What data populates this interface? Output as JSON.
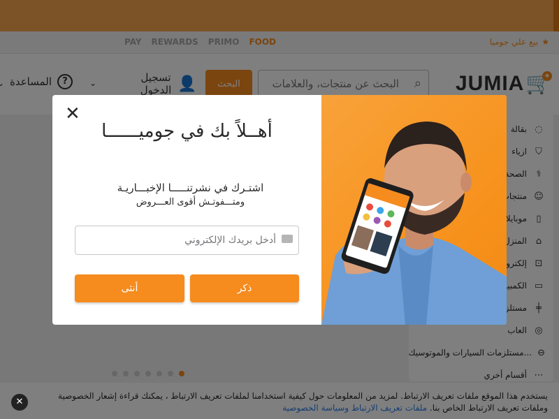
{
  "topbar": {
    "sell_label": "بيع علي جوميا",
    "brands": [
      "PAY",
      "REWARDS",
      "PRIMO",
      "FOOD"
    ]
  },
  "header": {
    "logo": "JUMIA",
    "search_placeholder": "البحث عن منتجات، والعلامات",
    "search_button": "البحث",
    "account_label": "تسجيل الدخول",
    "help_label": "المساعدة"
  },
  "sidebar": {
    "items": [
      {
        "label": "بقالة",
        "icon": "apple-icon"
      },
      {
        "label": "ازياء",
        "icon": "shirt-icon"
      },
      {
        "label": "الصحة",
        "icon": "health-icon"
      },
      {
        "label": "منتجات",
        "icon": "baby-icon"
      },
      {
        "label": "موبايلات",
        "icon": "phone-icon"
      },
      {
        "label": "المنزل",
        "icon": "home-icon"
      },
      {
        "label": "إلكترون",
        "icon": "radio-icon"
      },
      {
        "label": "الكمبيو",
        "icon": "monitor-icon"
      },
      {
        "label": "مستلزم",
        "icon": "dumbbell-icon"
      },
      {
        "label": "العاب",
        "icon": "gamepad-icon"
      },
      {
        "label": "مستلزمات السيارات والموتوسيك...",
        "icon": "car-icon"
      },
      {
        "label": "أقسام أخري",
        "icon": "more-icon"
      }
    ]
  },
  "carousel": {
    "active_index": 0,
    "count": 7
  },
  "modal": {
    "title": "أهــلاً بك في جوميــــــا",
    "subtitle1": "اشتـرك في نشرتنـــــا الإخبـــاريـة",
    "subtitle2": "ومتـــفوتـش أقوى العـــروض",
    "email_placeholder": "أدخل بريدك الإلكتروني",
    "male_button": "ذكر",
    "female_button": "أنثى"
  },
  "cookie": {
    "text": "يستخدم هذا الموقع ملفات تعريف الارتباط. لمزيد من المعلومات حول كيفية استخدامنا لملفات تعريف الارتباط ، يمكنك قراءة إشعار الخصوصية وملفات تعريف الارتباط الخاص بنا. ",
    "link": "ملفات تعريف الارتباط وسياسة الخصوصية"
  },
  "colors": {
    "accent": "#f68b1e",
    "overlay": "rgba(0,0,0,0.5)"
  }
}
